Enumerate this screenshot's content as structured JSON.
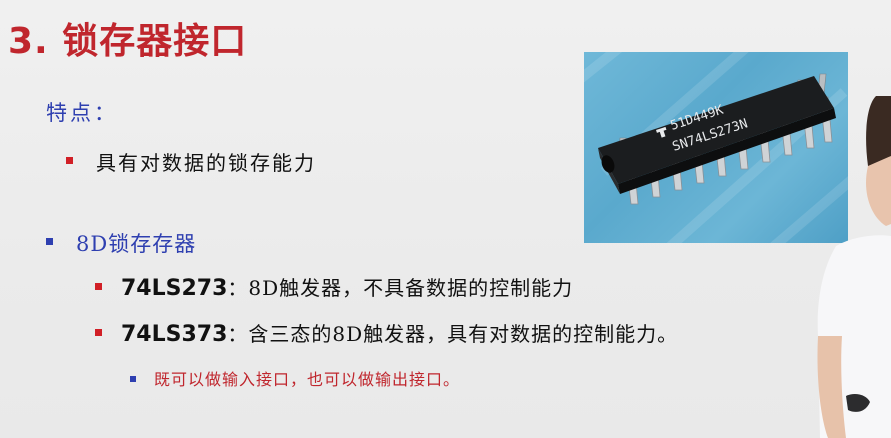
{
  "slide": {
    "title": "3. 锁存器接口",
    "features_label": "特点：",
    "feature_item": "具有对数据的锁存能力",
    "section_item": "8D锁存存器",
    "chips": [
      {
        "name": "74LS273",
        "sep": "：",
        "desc": "8D触发器，不具备数据的控制能力"
      },
      {
        "name": "74LS373",
        "sep": "：",
        "desc": "含三态的8D触发器，具有对数据的控制能力。"
      }
    ],
    "sub_item": "既可以做输入接口，也可以做输出接口。",
    "photo": {
      "chip_line1": "51D449K",
      "chip_line2": "SN74LS273N"
    }
  },
  "colors": {
    "title": "#c0262d",
    "accent_blue": "#2e3fb0",
    "bullet_red": "#d11f26"
  }
}
